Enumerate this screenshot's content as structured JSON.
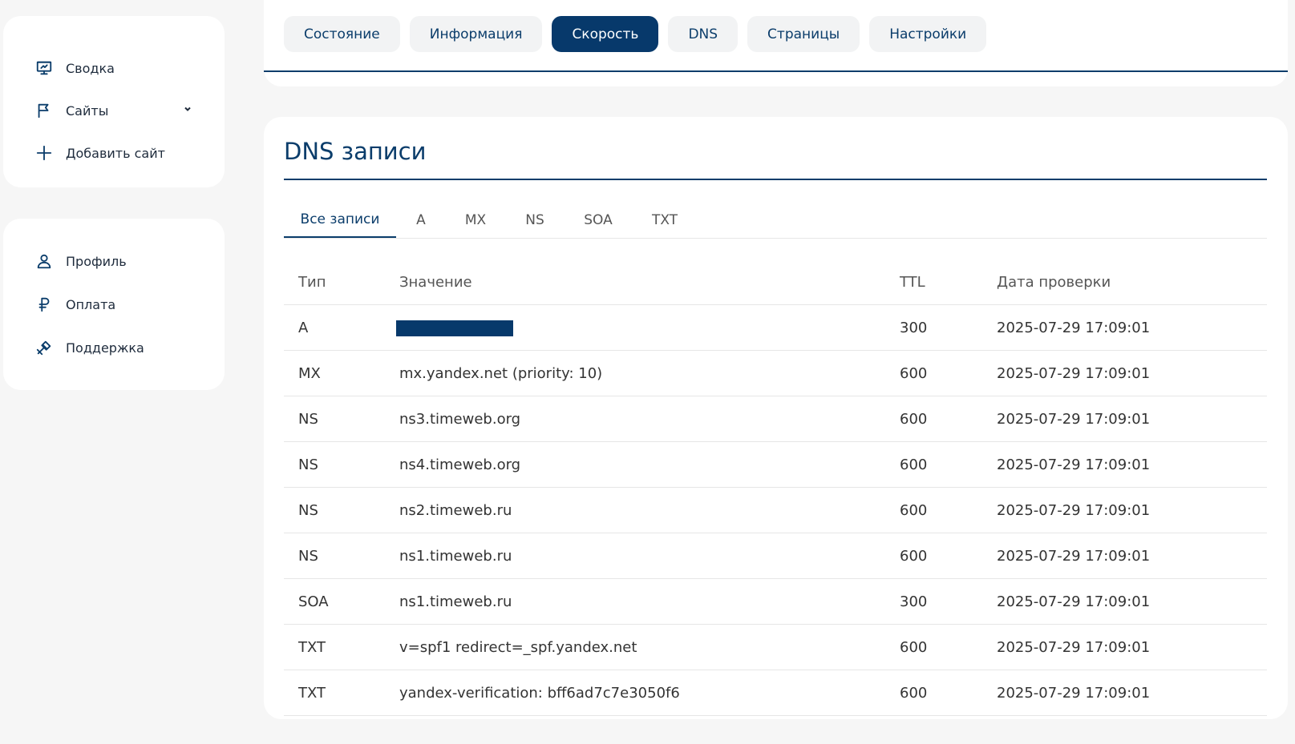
{
  "sidebar": {
    "main_items": [
      {
        "label": "Сводка",
        "icon": "presentation-icon"
      },
      {
        "label": "Сайты",
        "icon": "flag-icon"
      },
      {
        "label": "Добавить сайт",
        "icon": "plus-icon"
      }
    ],
    "account_items": [
      {
        "label": "Профиль",
        "icon": "user-icon"
      },
      {
        "label": "Оплата",
        "icon": "ruble-icon"
      },
      {
        "label": "Поддержка",
        "icon": "tools-icon"
      }
    ]
  },
  "top_tabs": [
    {
      "label": "Состояние"
    },
    {
      "label": "Информация"
    },
    {
      "label": "Скорость",
      "active": true
    },
    {
      "label": "DNS"
    },
    {
      "label": "Страницы"
    },
    {
      "label": "Настройки"
    }
  ],
  "dns": {
    "title": "DNS записи",
    "filter_tabs": [
      {
        "label": "Все записи",
        "active": true
      },
      {
        "label": "A"
      },
      {
        "label": "MX"
      },
      {
        "label": "NS"
      },
      {
        "label": "SOA"
      },
      {
        "label": "TXT"
      }
    ],
    "columns": [
      "Тип",
      "Значение",
      "TTL",
      "Дата проверки"
    ],
    "rows": [
      {
        "type": "A",
        "value": "",
        "redacted": true,
        "ttl": "300",
        "date": "2025-07-29 17:09:01"
      },
      {
        "type": "MX",
        "value": "mx.yandex.net (priority: 10)",
        "ttl": "600",
        "date": "2025-07-29 17:09:01"
      },
      {
        "type": "NS",
        "value": "ns3.timeweb.org",
        "ttl": "600",
        "date": "2025-07-29 17:09:01"
      },
      {
        "type": "NS",
        "value": "ns4.timeweb.org",
        "ttl": "600",
        "date": "2025-07-29 17:09:01"
      },
      {
        "type": "NS",
        "value": "ns2.timeweb.ru",
        "ttl": "600",
        "date": "2025-07-29 17:09:01"
      },
      {
        "type": "NS",
        "value": "ns1.timeweb.ru",
        "ttl": "600",
        "date": "2025-07-29 17:09:01"
      },
      {
        "type": "SOA",
        "value": "ns1.timeweb.ru",
        "ttl": "300",
        "date": "2025-07-29 17:09:01"
      },
      {
        "type": "TXT",
        "value": "v=spf1 redirect=_spf.yandex.net",
        "ttl": "600",
        "date": "2025-07-29 17:09:01"
      },
      {
        "type": "TXT",
        "value": "yandex-verification: bff6ad7c7e3050f6",
        "ttl": "600",
        "date": "2025-07-29 17:09:01"
      }
    ]
  },
  "colors": {
    "accent": "#07396b",
    "background": "#f6f6f6",
    "card": "#ffffff"
  }
}
